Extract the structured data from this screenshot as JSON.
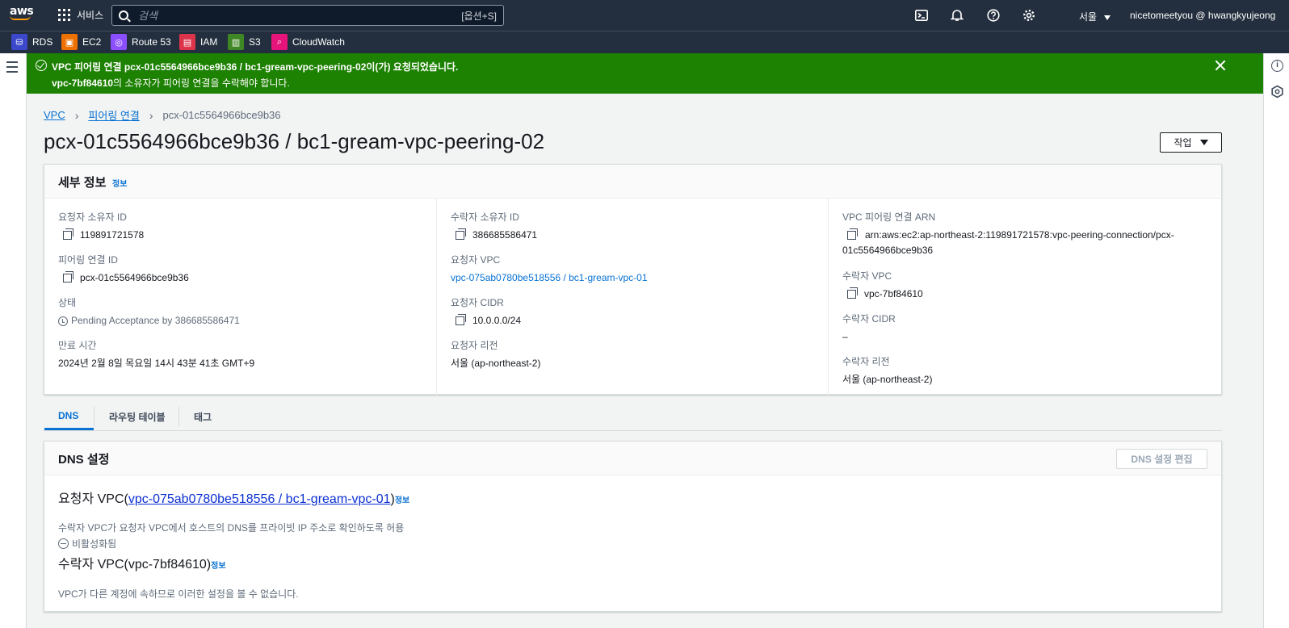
{
  "topnav": {
    "logo": "aws",
    "services_label": "서비스",
    "search_placeholder": "검색",
    "search_shortcut": "[옵션+S]",
    "region": "서울",
    "account": "nicetomeetyou @ hwangkyujeong",
    "icons": [
      "cloudshell-icon",
      "bell-icon",
      "help-icon",
      "settings-icon"
    ]
  },
  "favorites": [
    {
      "label": "RDS",
      "color": "#3b48cc"
    },
    {
      "label": "EC2",
      "color": "#ed7100"
    },
    {
      "label": "Route 53",
      "color": "#8c4fff"
    },
    {
      "label": "IAM",
      "color": "#dd344c"
    },
    {
      "label": "S3",
      "color": "#3f8624"
    },
    {
      "label": "CloudWatch",
      "color": "#e7157b"
    }
  ],
  "flash": {
    "line1": "VPC 피어링 연결 pcx-01c5564966bce9b36 / bc1-gream-vpc-peering-02이(가) 요청되었습니다.",
    "line2_bold": "vpc-7bf84610",
    "line2_rest": "의 소유자가 피어링 연결을 수락해야 합니다.",
    "color": "#1d8102"
  },
  "breadcrumb": {
    "items": [
      "VPC",
      "피어링 연결"
    ],
    "current": "pcx-01c5564966bce9b36"
  },
  "page": {
    "title": "pcx-01c5564966bce9b36 / bc1-gream-vpc-peering-02",
    "actions_label": "작업"
  },
  "details": {
    "title": "세부 정보",
    "info": "정보",
    "col1": {
      "requester_owner_label": "요청자 소유자 ID",
      "requester_owner": "119891721578",
      "peering_id_label": "피어링 연결 ID",
      "peering_id": "pcx-01c5564966bce9b36",
      "status_label": "상태",
      "status": "Pending Acceptance by 386685586471",
      "expiry_label": "만료 시간",
      "expiry": "2024년 2월 8일 목요일 14시 43분 41초 GMT+9"
    },
    "col2": {
      "accepter_owner_label": "수락자 소유자 ID",
      "accepter_owner": "386685586471",
      "requester_vpc_label": "요청자 VPC",
      "requester_vpc": "vpc-075ab0780be518556 / bc1-gream-vpc-01",
      "requester_cidr_label": "요청자 CIDR",
      "requester_cidr": "10.0.0.0/24",
      "requester_region_label": "요청자 리전",
      "requester_region": "서울 (ap-northeast-2)"
    },
    "col3": {
      "arn_label": "VPC 피어링 연결 ARN",
      "arn_line1": "arn:aws:ec2:ap-northeast-2:119891721578:vpc-peering-connection/pcx-",
      "arn_line2": "01c5564966bce9b36",
      "accepter_vpc_label": "수락자 VPC",
      "accepter_vpc": "vpc-7bf84610",
      "accepter_cidr_label": "수락자 CIDR",
      "accepter_cidr": "–",
      "accepter_region_label": "수락자 리전",
      "accepter_region": "서울 (ap-northeast-2)"
    }
  },
  "tabs": [
    "DNS",
    "라우팅 테이블",
    "태그"
  ],
  "dns": {
    "title": "DNS 설정",
    "edit_label": "DNS 설정 편집",
    "requester_prefix": "요청자 VPC(",
    "requester_link": "vpc-075ab0780be518556 / bc1-gream-vpc-01",
    "requester_suffix": ")",
    "info": "정보",
    "desc": "수락자 VPC가 요청자 VPC에서 호스트의 DNS를 프라이빗 IP 주소로 확인하도록 허용",
    "status": "비활성화됨",
    "accepter_title": "수락자 VPC(vpc-7bf84610)",
    "note": "VPC가 다른 계정에 속하므로 이러한 설정을 볼 수 없습니다."
  }
}
